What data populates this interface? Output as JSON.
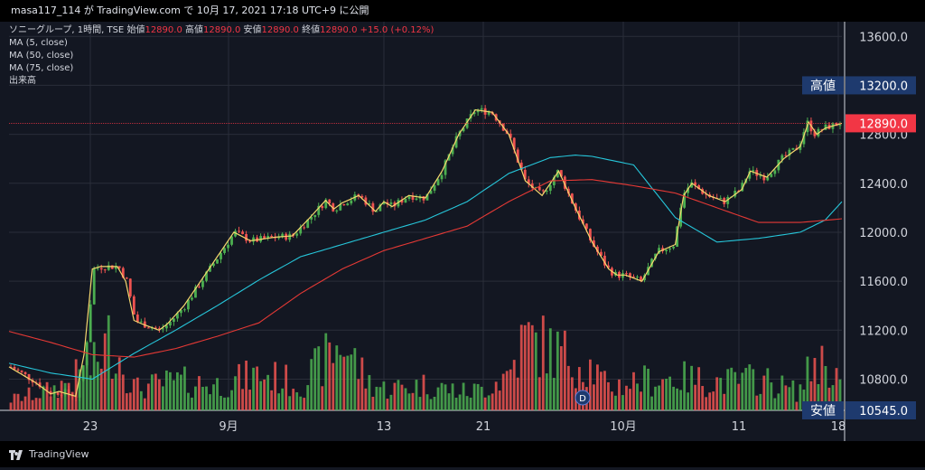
{
  "publish_line": "masa117_114 が TradingView.com で 10月 17, 2021 17:18 UTC+9 に公開",
  "brand": "TradingView",
  "legend": {
    "symbol": "ソニーグループ, 1時間, TSE",
    "open_label": "始値",
    "open": "12890.0",
    "high_label": "高値",
    "high": "12890.0",
    "low_label": "安値",
    "low": "12890.0",
    "close_label": "終値",
    "close": "12890.0",
    "change": "+15.0 (+0.12%)",
    "ma_lines": [
      "MA (5, close)",
      "MA (50, close)",
      "MA (75, close)"
    ],
    "volume": "出来高"
  },
  "colors": {
    "up": "#4caf50",
    "down": "#ef5350",
    "ma5": "#f5d76e",
    "ma50": "#26c6da",
    "ma75": "#e53935",
    "bg": "#131722",
    "price_tag": "#f23645",
    "label_tag": "#1e3a6e"
  },
  "chart_data": {
    "type": "line",
    "y_ticks": [
      "13600.0",
      "13200.0",
      "12800.0",
      "12400.0",
      "12000.0",
      "11600.0",
      "11200.0",
      "10800.0"
    ],
    "ylim": [
      10545,
      13720
    ],
    "x_ticks": [
      "23",
      "9月",
      "13",
      "21",
      "10月",
      "11",
      "18"
    ],
    "grid": true,
    "markers": {
      "high_label": "高値",
      "high_value": "13200.0",
      "low_label": "安値",
      "low_value": "10545.0",
      "current_value": "12890.0"
    },
    "event_badge": "D",
    "series": [
      {
        "name": "MA (5, close)",
        "x": [
          0,
          3,
          5,
          6,
          8,
          9,
          10,
          11,
          13,
          14,
          15,
          16,
          18,
          19,
          21,
          23,
          25,
          27,
          29,
          32,
          34,
          36,
          38,
          39,
          40,
          42,
          44,
          45,
          46,
          48,
          50,
          52,
          54,
          56,
          58,
          60,
          62,
          64,
          66,
          68,
          70,
          72,
          73,
          74,
          76,
          78,
          80,
          81,
          82,
          84,
          86,
          88,
          89,
          91,
          93,
          95,
          96,
          97,
          98,
          100
        ],
        "y": [
          10900,
          10780,
          10680,
          10700,
          10660,
          11000,
          11700,
          11720,
          11720,
          11600,
          11280,
          11250,
          11200,
          11250,
          11400,
          11600,
          11800,
          12000,
          11930,
          11960,
          11970,
          12110,
          12260,
          12190,
          12240,
          12300,
          12170,
          12250,
          12210,
          12300,
          12280,
          12500,
          12800,
          13000,
          12980,
          12800,
          12420,
          12300,
          12500,
          12200,
          11920,
          11700,
          11650,
          11650,
          11600,
          11840,
          11900,
          12300,
          12400,
          12300,
          12250,
          12350,
          12500,
          12450,
          12600,
          12700,
          12900,
          12800,
          12850,
          12890
        ]
      },
      {
        "name": "MA (50, close)",
        "x": [
          0,
          5,
          10,
          15,
          20,
          25,
          30,
          35,
          40,
          45,
          50,
          55,
          60,
          65,
          68,
          70,
          75,
          80,
          85,
          90,
          95,
          98,
          100
        ],
        "y": [
          10930,
          10850,
          10800,
          11010,
          11200,
          11400,
          11610,
          11800,
          11900,
          12000,
          12100,
          12250,
          12480,
          12610,
          12630,
          12620,
          12550,
          12120,
          11920,
          11950,
          12000,
          12100,
          12250
        ]
      },
      {
        "name": "MA (75, close)",
        "x": [
          0,
          5,
          10,
          15,
          20,
          25,
          30,
          35,
          40,
          45,
          50,
          55,
          60,
          65,
          70,
          75,
          80,
          85,
          90,
          95,
          100
        ],
        "y": [
          11190,
          11100,
          11000,
          10980,
          11050,
          11150,
          11260,
          11500,
          11700,
          11850,
          11950,
          12050,
          12250,
          12420,
          12430,
          12380,
          12320,
          12200,
          12080,
          12080,
          12110
        ]
      },
      {
        "name": "volume",
        "x": [
          0,
          5,
          10,
          12,
          15,
          20,
          25,
          30,
          32,
          35,
          40,
          43,
          45,
          50,
          55,
          57,
          60,
          62,
          65,
          70,
          72,
          75,
          80,
          85,
          88,
          90,
          95,
          97,
          99,
          100
        ],
        "y": [
          15,
          28,
          60,
          100,
          30,
          40,
          35,
          50,
          45,
          35,
          95,
          40,
          30,
          35,
          25,
          30,
          50,
          100,
          85,
          60,
          30,
          40,
          45,
          40,
          40,
          45,
          25,
          70,
          60,
          40
        ]
      }
    ]
  }
}
